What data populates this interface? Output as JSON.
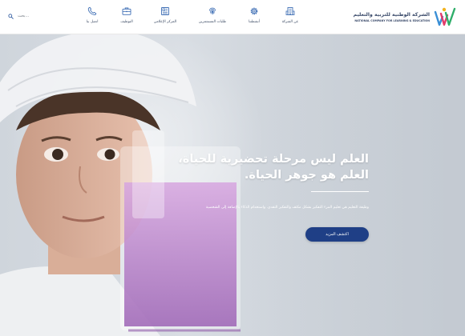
{
  "header": {
    "search_label": "بحث...",
    "logo": {
      "name_ar": "الشركة الوطنية للتربية والتعليم",
      "name_en": "NATIONAL COMPANY FOR LEARNING & EDUCATION"
    },
    "nav": [
      {
        "label": "عن الشركة",
        "icon": "building-icon"
      },
      {
        "label": "أنشطتنا",
        "icon": "gear-icon"
      },
      {
        "label": "طلبات المستثمرين",
        "icon": "fingerprint-icon"
      },
      {
        "label": "المركز الإعلامي",
        "icon": "newspaper-icon"
      },
      {
        "label": "التوظيف",
        "icon": "briefcase-icon"
      },
      {
        "label": "اتصل بنا",
        "icon": "phone-icon"
      }
    ]
  },
  "hero": {
    "title_line1": "العلم ليس مرحلة تحضيرية للحياة،",
    "title_line2": "العلم هو جوهر الحياة.",
    "subtitle": "وظيفة التعليم هي تعليم المرء التفكير بشكل مكثف والتفكير النقدي. واستخدام الذكاء بالإضافة إلى الشخصية",
    "cta_label": "اكتشف المزيد"
  },
  "colors": {
    "brand_navy": "#1f3f86",
    "nav_text": "#3b4a63",
    "nav_icon": "#3f6fb5"
  }
}
